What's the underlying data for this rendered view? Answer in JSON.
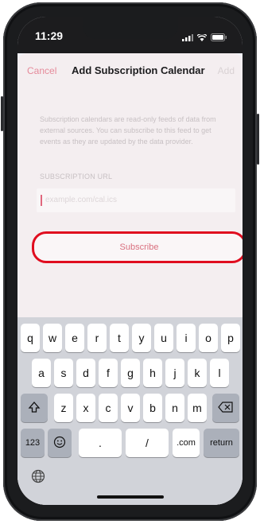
{
  "status_bar": {
    "time": "11:29"
  },
  "nav": {
    "cancel_label": "Cancel",
    "title": "Add Subscription Calendar",
    "add_label": "Add"
  },
  "form": {
    "description": "Subscription calendars are read-only feeds of data from external sources. You can subscribe to this feed to get events as they are updated by the data provider.",
    "url_label": "SUBSCRIPTION URL",
    "url_placeholder": "example.com/cal.ics",
    "url_value": ""
  },
  "subscribe_label": "Subscribe",
  "highlight_color": "#e00d1f",
  "keyboard": {
    "row1": [
      "q",
      "w",
      "e",
      "r",
      "t",
      "y",
      "u",
      "i",
      "o",
      "p"
    ],
    "row2": [
      "a",
      "s",
      "d",
      "f",
      "g",
      "h",
      "j",
      "k",
      "l"
    ],
    "row3": [
      "z",
      "x",
      "c",
      "v",
      "b",
      "n",
      "m"
    ],
    "shift_icon": "shift-icon",
    "delete_icon": "delete-icon",
    "numbers_label": "123",
    "emoji_icon": "emoji-icon",
    "period_label": ".",
    "slash_label": "/",
    "dotcom_label": ".com",
    "return_label": "return",
    "globe_icon": "globe-icon"
  }
}
